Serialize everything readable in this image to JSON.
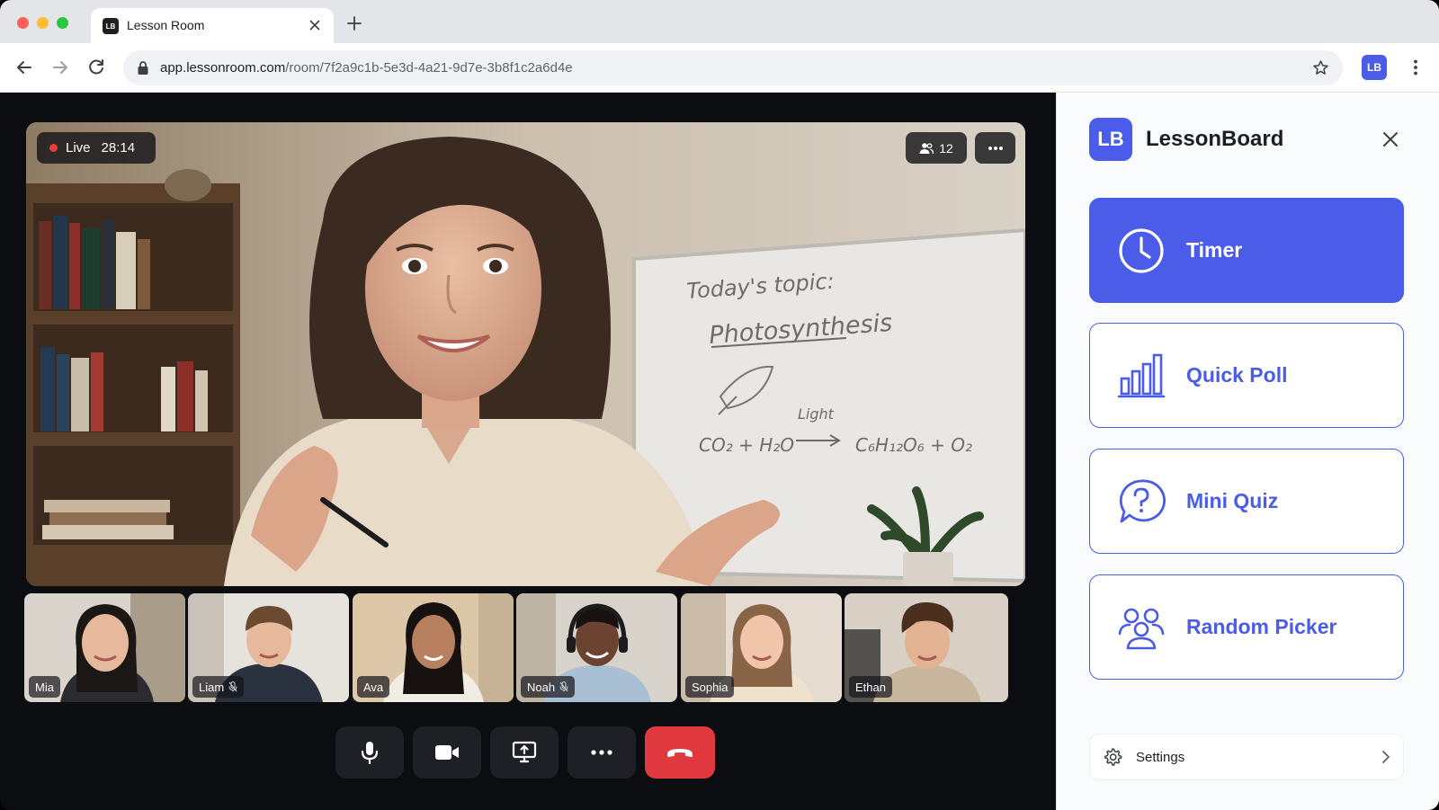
{
  "browser": {
    "tab_title": "Lesson Room",
    "tab_favicon": "LB",
    "url_host": "app.lessonroom.com",
    "url_path": "/room/7f2a9c1b-5e3d-4a21-9d7e-3b8f1c2a6d4e",
    "profile_initials": "LB",
    "icons": [
      "back-icon",
      "forward-icon",
      "reload-icon",
      "lock-icon",
      "star-icon",
      "kebab-icon",
      "close-icon",
      "plus-icon"
    ]
  },
  "meeting": {
    "live_label": "Live",
    "elapsed": "28:14",
    "participant_count": "12",
    "whiteboard": {
      "line1": "Today's topic:",
      "line2": "Photosynthesis",
      "light_label": "Light",
      "equation_left": "CO₂ + H₂O",
      "equation_right": "C₆H₁₂O₆ + O₂"
    },
    "participants": [
      {
        "name": "Mia",
        "muted": false
      },
      {
        "name": "Liam",
        "muted": true
      },
      {
        "name": "Ava",
        "muted": false
      },
      {
        "name": "Noah",
        "muted": true
      },
      {
        "name": "Sophia",
        "muted": false
      },
      {
        "name": "Ethan",
        "muted": false
      }
    ],
    "controls": [
      "microphone-icon",
      "camera-icon",
      "screen-share-icon",
      "more-icon",
      "end-call-icon"
    ]
  },
  "panel": {
    "logo": "LB",
    "title": "LessonBoard",
    "tools": [
      {
        "label": "Timer",
        "icon": "clock-icon",
        "active": true
      },
      {
        "label": "Quick Poll",
        "icon": "bar-chart-icon",
        "active": false
      },
      {
        "label": "Mini Quiz",
        "icon": "question-bubble-icon",
        "active": false
      },
      {
        "label": "Random Picker",
        "icon": "people-icon",
        "active": false
      }
    ],
    "settings_label": "Settings"
  },
  "colors": {
    "accent": "#4a5ce8",
    "end_call": "#e0393f",
    "live_dot": "#ea3b3b",
    "stage_bg": "#0c0d10"
  }
}
